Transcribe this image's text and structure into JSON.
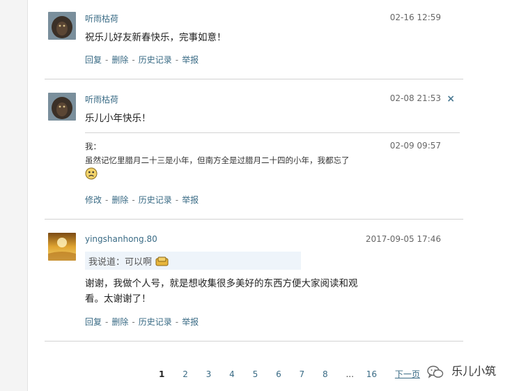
{
  "comments": [
    {
      "author": "听雨枯荷",
      "time": "02-16 12:59",
      "text": "祝乐儿好友新春快乐，完事如意！",
      "actions": [
        "回复",
        "删除",
        "历史记录",
        "举报"
      ]
    },
    {
      "author": "听雨枯荷",
      "time": "02-08 21:53",
      "text": "乐儿小年快乐！",
      "close": "×",
      "reply": {
        "label": "我：",
        "time": "02-09 09:57",
        "text": "虽然记忆里腊月二十三是小年，但南方全是过腊月二十四的小年，我都忘了",
        "emoji": "sad-face-emoji"
      },
      "actions": [
        "修改",
        "删除",
        "历史记录",
        "举报"
      ]
    },
    {
      "author": "yingshanhong.80",
      "time": "2017-09-05 17:46",
      "quote": "我说道：可以啊",
      "text_line1": "谢谢，我做个人号，就是想收集很多美好的东西方便大家阅读和观",
      "text_line2": "看。太谢谢了！",
      "actions": [
        "回复",
        "删除",
        "历史记录",
        "举报"
      ]
    }
  ],
  "pagination": {
    "pages": [
      "1",
      "2",
      "3",
      "4",
      "5",
      "6",
      "7",
      "8"
    ],
    "ellipsis": "...",
    "last": "16",
    "next": "下一页"
  },
  "watermark": {
    "text": "乐儿小筑",
    "icon": "wechat-icon"
  },
  "colors": {
    "link": "#3a6b85",
    "separator": "#d2d2d2",
    "quote_bg": "#eef4fa"
  }
}
